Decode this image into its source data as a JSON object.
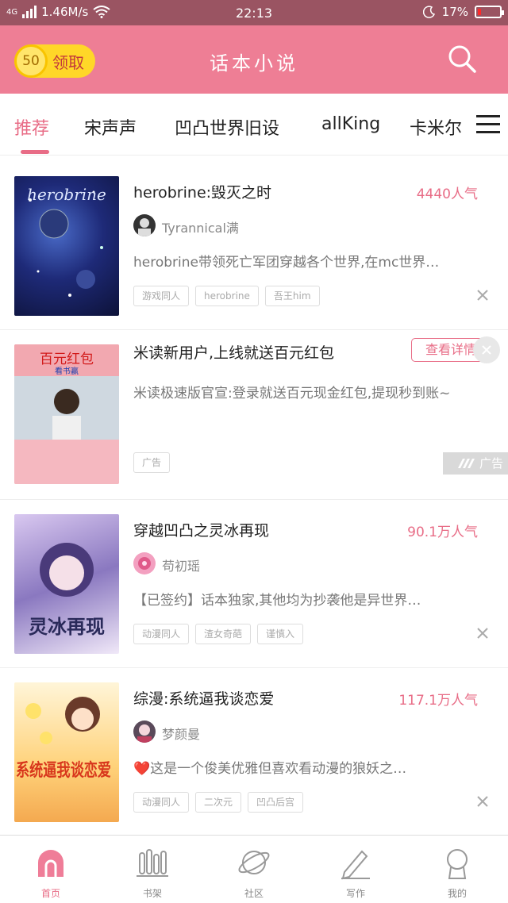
{
  "status_bar": {
    "network": "4G",
    "speed": "1.46M/s",
    "time": "22:13",
    "battery": "17%",
    "battery_level": 0.17
  },
  "app_bar": {
    "coin_count": "50",
    "coin_label": "领取",
    "title": "话本小说"
  },
  "tabs": [
    {
      "label": "推荐",
      "active": true
    },
    {
      "label": "宋声声"
    },
    {
      "label": "凹凸世界旧设"
    },
    {
      "label": "allKing"
    },
    {
      "label": "卡米尔"
    }
  ],
  "feed": [
    {
      "title": "herobrine:毁灭之时",
      "popularity": "4440人气",
      "author": "Tyrannical满",
      "description": "herobrine带领死亡军团穿越各个世界,在mc世界…",
      "tags": [
        "游戏同人",
        "herobrine",
        "吾王him"
      ],
      "cover_text": "herobrine"
    },
    {
      "title": "米读新用户,上线就送百元红包",
      "button": "查看详情",
      "description": "米读极速版官宣:登录就送百元现金红包,提现秒到账~",
      "tag": "广告",
      "badge": "广告",
      "cover_text": "百元红包",
      "cover_sub": "看书赢"
    },
    {
      "title": "穿越凹凸之灵冰再现",
      "popularity": "90.1万人气",
      "author": "苟初瑶",
      "description": "【已签约】话本独家,其他均为抄袭他是异世界…",
      "tags": [
        "动漫同人",
        "渣女奇葩",
        "谨慎入"
      ],
      "cover_text": "灵冰再现"
    },
    {
      "title": "综漫:系统逼我谈恋爱",
      "popularity": "117.1万人气",
      "author": "梦颜曼",
      "description": "❤️这是一个俊美优雅但喜欢看动漫的狼妖之…",
      "tags": [
        "动漫同人",
        "二次元",
        "凹凸后宫"
      ],
      "cover_text": "系统逼我谈恋爱"
    }
  ],
  "bottom_nav": [
    {
      "label": "首页",
      "active": true
    },
    {
      "label": "书架"
    },
    {
      "label": "社区"
    },
    {
      "label": "写作"
    },
    {
      "label": "我的"
    }
  ],
  "colors": {
    "accent": "#e86c86",
    "app_bar": "#ee7e95",
    "status_bar": "#9a5462",
    "coin": "#ffd728"
  }
}
